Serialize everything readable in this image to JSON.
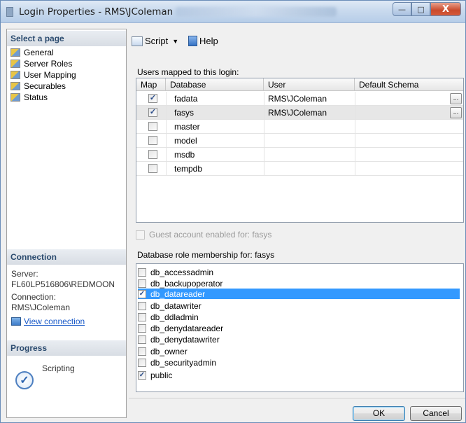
{
  "window": {
    "title": "Login Properties - RMS\\JColeman",
    "controls": {
      "minimize": "—",
      "maximize": "□",
      "close": "X"
    }
  },
  "left": {
    "select_page_header": "Select a page",
    "pages": [
      {
        "label": "General",
        "icon": "page-icon"
      },
      {
        "label": "Server Roles",
        "icon": "page-icon"
      },
      {
        "label": "User Mapping",
        "icon": "page-icon"
      },
      {
        "label": "Securables",
        "icon": "page-icon"
      },
      {
        "label": "Status",
        "icon": "page-icon"
      }
    ],
    "connection_header": "Connection",
    "server_label": "Server:",
    "server_value": "FL60LP516806\\REDMOON",
    "connection_label": "Connection:",
    "connection_value": "RMS\\JColeman",
    "view_connection": "View connection",
    "progress_header": "Progress",
    "progress_status": "Scripting"
  },
  "toolbar": {
    "script_label": "Script",
    "help_label": "Help"
  },
  "users_grid": {
    "label": "Users mapped to this login:",
    "columns": [
      "Map",
      "Database",
      "User",
      "Default Schema"
    ],
    "rows": [
      {
        "map": true,
        "database": "fadata",
        "user": "RMS\\JColeman",
        "default_schema": "",
        "has_button": true
      },
      {
        "map": true,
        "database": "fasys",
        "user": "RMS\\JColeman",
        "default_schema": "",
        "has_button": true
      },
      {
        "map": false,
        "database": "master",
        "user": "",
        "default_schema": "",
        "has_button": false
      },
      {
        "map": false,
        "database": "model",
        "user": "",
        "default_schema": "",
        "has_button": false
      },
      {
        "map": false,
        "database": "msdb",
        "user": "",
        "default_schema": "",
        "has_button": false
      },
      {
        "map": false,
        "database": "tempdb",
        "user": "",
        "default_schema": "",
        "has_button": false
      }
    ],
    "ellipsis": "..."
  },
  "guest": {
    "label": "Guest account enabled for: fasys",
    "checked": false
  },
  "roles": {
    "label": "Database role membership for: fasys",
    "items": [
      {
        "name": "db_accessadmin",
        "checked": false,
        "selected": false
      },
      {
        "name": "db_backupoperator",
        "checked": false,
        "selected": false
      },
      {
        "name": "db_datareader",
        "checked": true,
        "selected": true
      },
      {
        "name": "db_datawriter",
        "checked": false,
        "selected": false
      },
      {
        "name": "db_ddladmin",
        "checked": false,
        "selected": false
      },
      {
        "name": "db_denydatareader",
        "checked": false,
        "selected": false
      },
      {
        "name": "db_denydatawriter",
        "checked": false,
        "selected": false
      },
      {
        "name": "db_owner",
        "checked": false,
        "selected": false
      },
      {
        "name": "db_securityadmin",
        "checked": false,
        "selected": false
      },
      {
        "name": "public",
        "checked": true,
        "selected": false
      }
    ]
  },
  "buttons": {
    "ok": "OK",
    "cancel": "Cancel"
  },
  "check_glyph": "✓",
  "colors": {
    "selection": "#3399ff",
    "link": "#1a5ac8",
    "section_header": "#2a4a6e"
  }
}
